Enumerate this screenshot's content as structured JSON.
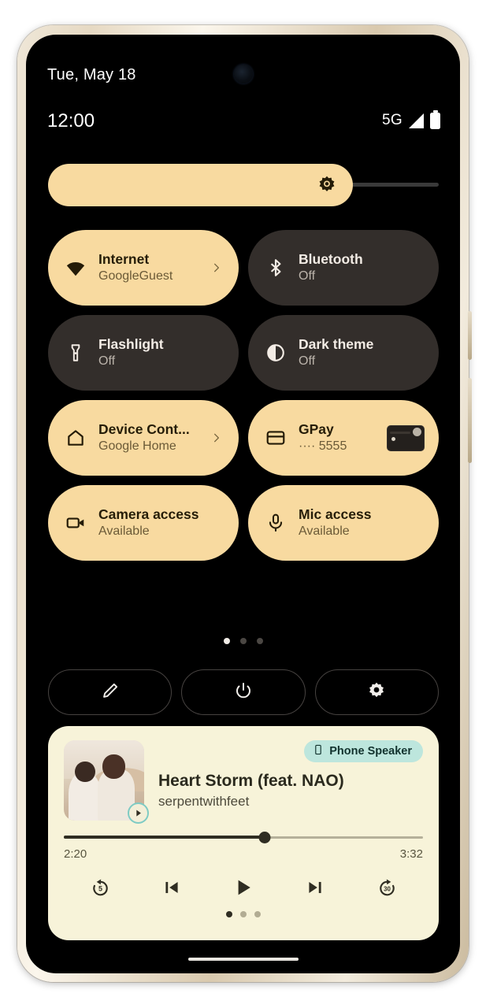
{
  "statusbar": {
    "date": "Tue, May 18",
    "time": "12:00",
    "network": "5G",
    "signal_icon": "signal-bars-icon",
    "battery_icon": "battery-full-icon"
  },
  "brightness": {
    "label": "Brightness",
    "icon": "brightness-sun-icon",
    "value_percent": 78
  },
  "tiles": [
    {
      "title": "Internet",
      "subtitle": "GoogleGuest",
      "icon": "wifi-icon",
      "state": "active",
      "chevron": true
    },
    {
      "title": "Bluetooth",
      "subtitle": "Off",
      "icon": "bluetooth-icon",
      "state": "inactive",
      "chevron": false
    },
    {
      "title": "Flashlight",
      "subtitle": "Off",
      "icon": "flashlight-icon",
      "state": "inactive",
      "chevron": false
    },
    {
      "title": "Dark theme",
      "subtitle": "Off",
      "icon": "dark-theme-contrast-icon",
      "state": "inactive",
      "chevron": false
    },
    {
      "title": "Device Cont...",
      "subtitle": "Google Home",
      "icon": "home-icon",
      "state": "active",
      "chevron": true
    },
    {
      "title": "GPay",
      "subtitle": "···· 5555",
      "icon": "credit-card-icon",
      "state": "active",
      "chevron": false,
      "thumbnail": "payment-card-thumbnail"
    },
    {
      "title": "Camera access",
      "subtitle": "Available",
      "icon": "video-camera-icon",
      "state": "active",
      "chevron": false
    },
    {
      "title": "Mic access",
      "subtitle": "Available",
      "icon": "microphone-icon",
      "state": "active",
      "chevron": false
    }
  ],
  "quick_settings_pager": {
    "total": 3,
    "active_index": 0
  },
  "footer_actions": [
    {
      "name": "edit-button",
      "icon": "pencil-icon"
    },
    {
      "name": "power-button",
      "icon": "power-icon"
    },
    {
      "name": "settings-button",
      "icon": "gear-icon"
    }
  ],
  "media": {
    "speaker_chip": {
      "label": "Phone Speaker",
      "icon": "phone-icon"
    },
    "title": "Heart Storm (feat. NAO)",
    "artist": "serpentwithfeet",
    "album_art_alt": "album-art",
    "play_badge_icon": "play-circle-icon",
    "elapsed": "2:20",
    "duration": "3:32",
    "progress_percent": 56,
    "controls": [
      {
        "name": "replay-5-button",
        "icon": "replay-5-icon",
        "label": "5"
      },
      {
        "name": "previous-track-button",
        "icon": "skip-previous-icon"
      },
      {
        "name": "play-button",
        "icon": "play-icon"
      },
      {
        "name": "next-track-button",
        "icon": "skip-next-icon"
      },
      {
        "name": "forward-30-button",
        "icon": "forward-30-icon",
        "label": "30"
      }
    ],
    "pager": {
      "total": 3,
      "active_index": 0
    }
  },
  "colors": {
    "accent_tan": "#f8daa0",
    "tile_inactive": "#332e2b",
    "media_card_bg": "#f7f3d9",
    "chip_bg": "#bde6dd",
    "screen_bg": "#000000"
  }
}
